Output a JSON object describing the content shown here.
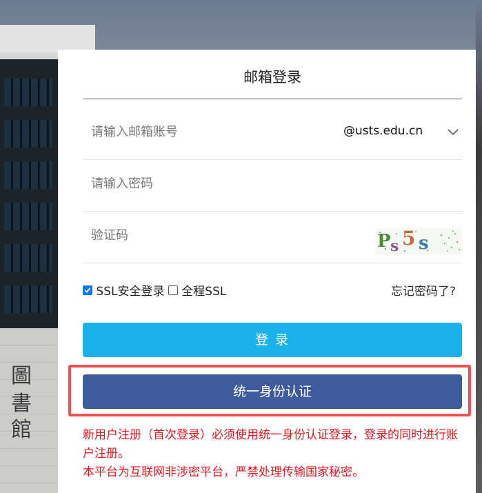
{
  "header": {
    "title": "邮箱登录"
  },
  "form": {
    "account_placeholder": "请输入邮箱账号",
    "domain_selected": "@usts.edu.cn",
    "password_placeholder": "请输入密码",
    "captcha_placeholder": "验证码",
    "captcha_text": "Ps5s"
  },
  "options": {
    "ssl_label": "SSL安全登录",
    "ssl_checked": true,
    "full_ssl_label": "全程SSL",
    "full_ssl_checked": false,
    "forgot_label": "忘记密码了?"
  },
  "buttons": {
    "login_label": "登 录",
    "sso_label": "统一身份认证"
  },
  "notice": {
    "line1": "新用户注册（首次登录）必须使用统一身份认证登录，登录的同时进行账户注册。",
    "line2": "本平台为互联网非涉密平台，严禁处理传输国家秘密。"
  },
  "background": {
    "calligraphy": [
      "圖",
      "書",
      "館"
    ]
  },
  "colors": {
    "login_button": "#1cb1e8",
    "sso_button": "#3e5b9b",
    "highlight_border": "#f05050",
    "notice_text": "#e8141e",
    "checkbox_checked": "#1677e8"
  }
}
